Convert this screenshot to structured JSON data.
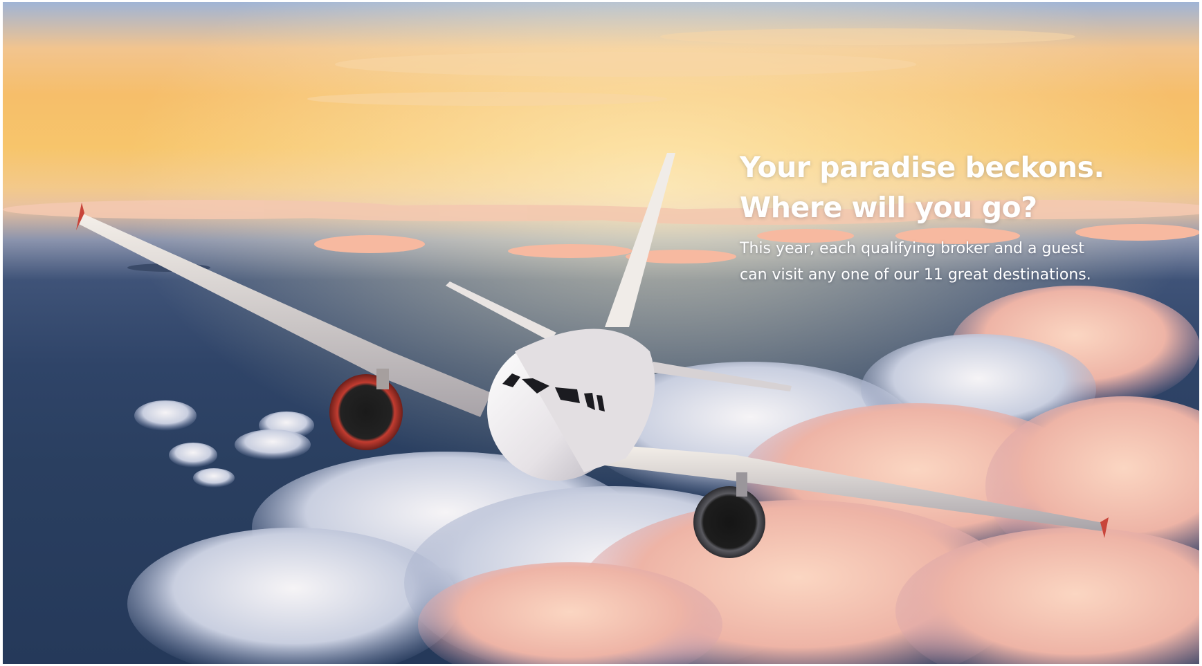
{
  "hero": {
    "headline_line1": "Your paradise beckons.",
    "headline_line2": "Where will you go?",
    "body_line1": "This year, each qualifying broker and a guest",
    "body_line2": "can visit any one of our 11 great destinations."
  },
  "colors": {
    "sky_top": "#9fb4d6",
    "sunset": "#f6be6a",
    "ocean": "#2f4468",
    "cloud_pink": "#f2b8a4",
    "text": "#ffffff"
  }
}
